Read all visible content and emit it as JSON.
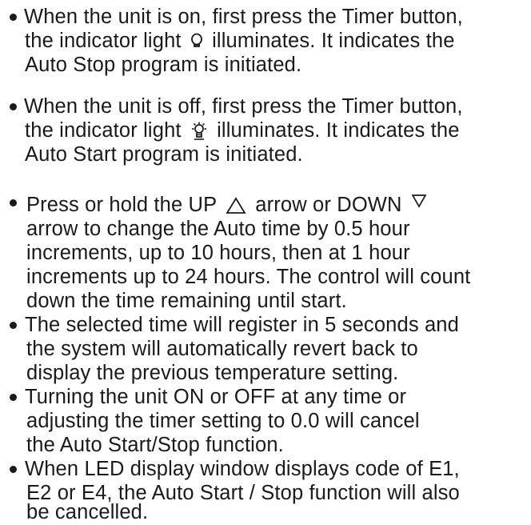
{
  "bullets": [
    {
      "lines": [
        "When the unit is on, first  press the Timer button,",
        [
          "the indicator light ",
          " illuminates. It indicates the"
        ],
        "Auto Stop program is initiated."
      ],
      "icon": "bulb-icon"
    },
    {
      "lines": [
        "When the unit is off, first  press the Timer button,",
        [
          "the indicator light ",
          " illuminates. It indicates the"
        ],
        "Auto Start program is initiated."
      ],
      "icon": "sun-bulb-icon"
    },
    {
      "lines": [
        [
          "Press or hold the UP ",
          "  arrow or DOWN ",
          ""
        ],
        "arrow to change the Auto time by 0.5 hour",
        "increments, up to 10 hours, then at 1 hour",
        "increments up to 24 hours. The control  will count",
        "down the time remaining until start."
      ],
      "icons": [
        "up-arrow-icon",
        "down-arrow-icon"
      ]
    },
    {
      "lines": [
        "The selected time will register in 5 seconds and",
        "the system will automatically revert back to",
        "display the previous temperature setting."
      ]
    },
    {
      "lines": [
        "Turning the unit ON or OFF at any time or",
        "adjusting the timer setting to 0.0 will cancel",
        "the Auto Start/Stop function."
      ]
    },
    {
      "lines": [
        "When LED display window displays code of E1,",
        "E2 or E4,  the Auto Start / Stop function will also",
        "be cancelled."
      ]
    }
  ]
}
